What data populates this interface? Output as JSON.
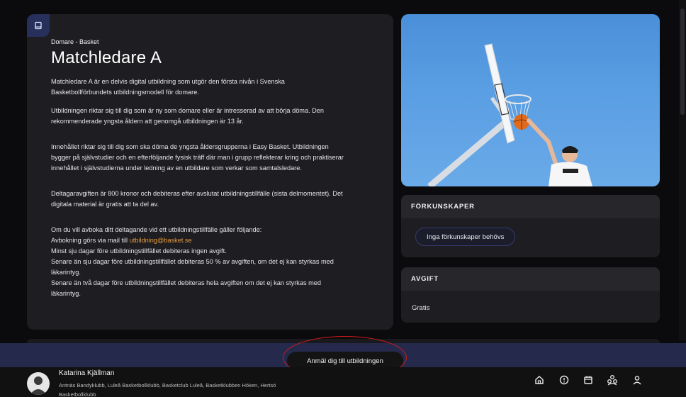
{
  "course": {
    "category": "Domare - Basket",
    "title": "Matchledare A",
    "paragraphs": {
      "p1": [
        "Matchledare A är en delvis digital utbildning som utgör den första nivån i Svenska",
        "Basketbollförbundets utbildningsmodell för domare."
      ],
      "p2": [
        "Utbildningen riktar sig till dig som är ny som domare eller är intresserad av att börja döma. Den",
        "rekommenderade yngsta åldern att genomgå utbildningen är 13 år."
      ],
      "p3": [
        "Innehållet riktar sig till dig som ska döma de yngsta åldersgrupperna i Easy Basket. Utbildningen",
        "bygger på självstudier och en efterföljande fysisk träff där man i grupp reflekterar kring och praktiserar",
        "innehållet i självstudierna under ledning av en utbildare som verkar som samtalsledare."
      ],
      "p4": [
        "Deltagaravgiften är 800 kronor och debiteras efter avslutat utbildningstillfälle (sista delmomentet). Det",
        "digitala material är gratis att ta del av."
      ],
      "p5": {
        "intro": "Om du vill avboka ditt deltagande vid ett utbildningstillfälle gäller följande:",
        "mail_prefix": "Avbokning görs via mail till ",
        "mail": "utbildning@basket.se",
        "rule1": "Minst sju dagar före utbildningstillfället debiteras ingen avgift.",
        "rule2a": "Senare än sju dagar före utbildningstillfället debiteras 50 % av avgiften, om det ej kan styrkas med",
        "rule2b": "läkarintyg.",
        "rule3a": "Senare än två dagar före utbildningstillfället debiteras hela avgiften om det ej kan styrkas med",
        "rule3b": "läkarintyg."
      }
    }
  },
  "prerequisites": {
    "header": "FÖRKUNSKAPER",
    "chip": "Inga förkunskaper behövs"
  },
  "fee": {
    "header": "AVGIFT",
    "value": "Gratis"
  },
  "cta": {
    "label": "Anmäl dig till utbildningen"
  },
  "user": {
    "name": "Katarina Kjällman",
    "clubs": "Antnäs Bandyklubb, Luleå Basketbollklubb, Basketclub Luleå, Basketklubben Höken, Hertsö Basketbollklubb"
  },
  "nav_icons": [
    "home-icon",
    "alert-icon",
    "calendar-icon",
    "group-icon",
    "user-icon"
  ],
  "colors": {
    "page_bg": "#0b0b0d",
    "card_bg": "#1e1e22",
    "accent_navy": "#252a4d",
    "link_orange": "#e79a3c",
    "annotation_red": "#d11b1b"
  }
}
